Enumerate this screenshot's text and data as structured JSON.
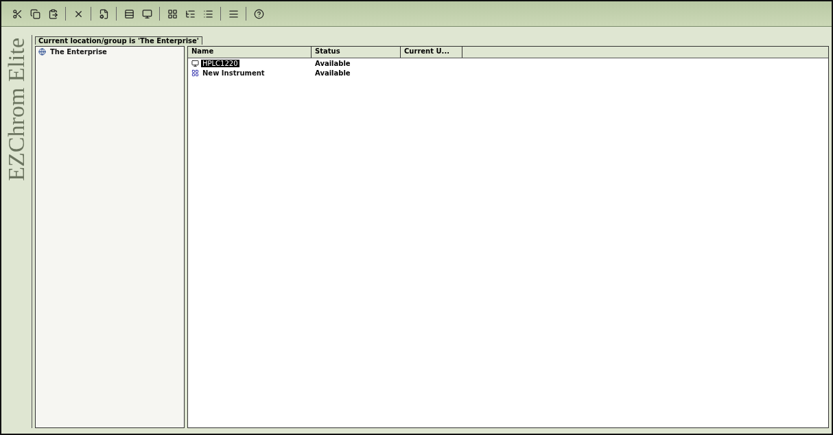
{
  "brand": {
    "text": "EZChrom Elite"
  },
  "location_bar": {
    "text": "Current location/group is 'The Enterprise'"
  },
  "tree": {
    "items": [
      {
        "label": "The Enterprise",
        "selected": false
      }
    ]
  },
  "table": {
    "columns": [
      "Name",
      "Status",
      "Current U..."
    ],
    "rows": [
      {
        "name": "HPLC1220",
        "status": "Available",
        "selected": true,
        "kind": "instrument"
      },
      {
        "name": "New Instrument",
        "status": "Available",
        "selected": false,
        "kind": "new"
      }
    ]
  }
}
